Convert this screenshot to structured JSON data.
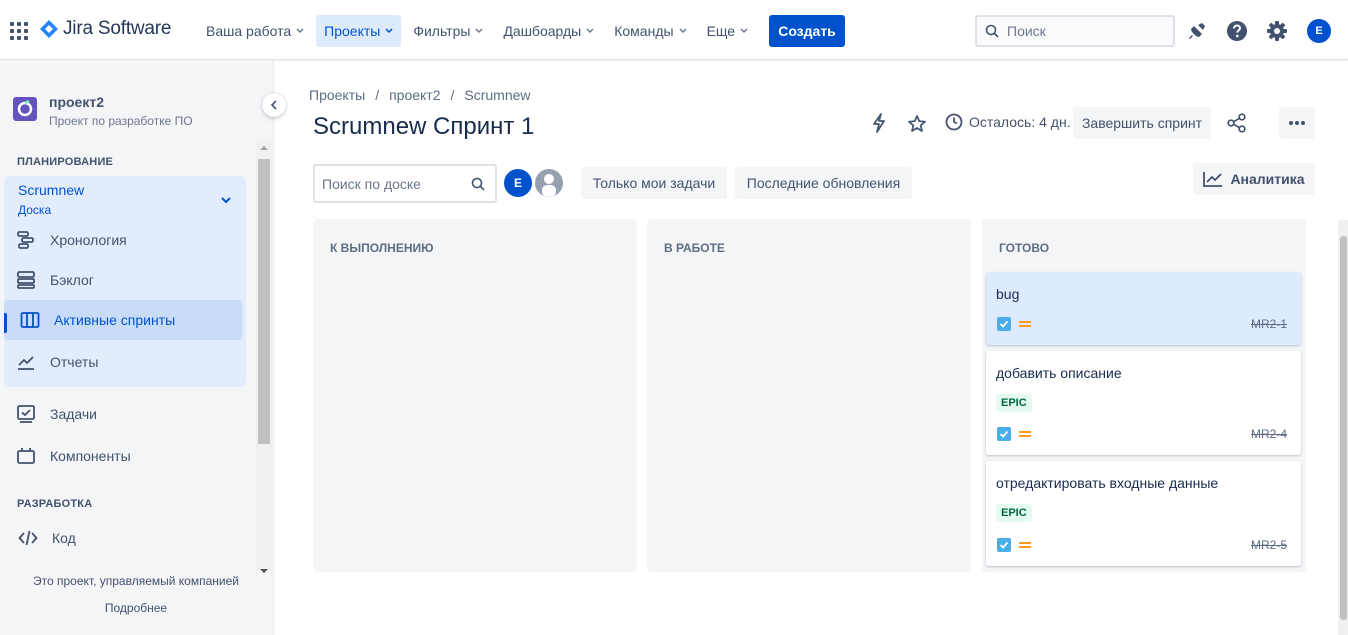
{
  "topnav": {
    "app_name": "Jira Software",
    "menu": [
      {
        "label": "Ваша работа"
      },
      {
        "label": "Проекты"
      },
      {
        "label": "Фильтры"
      },
      {
        "label": "Дашбоарды"
      },
      {
        "label": "Команды"
      },
      {
        "label": "Еще"
      }
    ],
    "create_label": "Создать",
    "search_placeholder": "Поиск",
    "avatar_initial": "E",
    "icons": [
      "app-switcher-icon",
      "notifications-icon",
      "help-icon",
      "settings-icon"
    ]
  },
  "sidebar": {
    "project_name": "проект2",
    "project_type": "Проект по разработке ПО",
    "planning_title": "ПЛАНИРОВАНИЕ",
    "board_name": "Scrumnew",
    "board_sub": "Доска",
    "items": [
      {
        "label": "Хронология",
        "icon": "roadmap-icon"
      },
      {
        "label": "Бэклог",
        "icon": "backlog-icon"
      },
      {
        "label": "Активные спринты",
        "icon": "board-icon"
      },
      {
        "label": "Отчеты",
        "icon": "reports-icon"
      },
      {
        "label": "Задачи",
        "icon": "issues-icon"
      },
      {
        "label": "Компоненты",
        "icon": "components-icon"
      }
    ],
    "dev_title": "РАЗРАБОТКА",
    "dev_items": [
      {
        "label": "Код",
        "icon": "code-icon"
      }
    ],
    "footer_text": "Это проект, управляемый компанией",
    "footer_link": "Подробнее"
  },
  "breadcrumbs": [
    "Проекты",
    "проект2",
    "Scrumnew"
  ],
  "header": {
    "title": "Scrumnew Спринт 1",
    "remaining": "Осталось: 4 дн.",
    "complete_sprint": "Завершить спринт"
  },
  "filters": {
    "search_placeholder": "Поиск по доске",
    "avatar_initial": "E",
    "only_my_issues": "Только мои задачи",
    "recent_updates": "Последние обновления",
    "analytics": "Аналитика"
  },
  "columns": [
    {
      "title": "К ВЫПОЛНЕНИЮ",
      "cards": []
    },
    {
      "title": "В РАБОТЕ",
      "cards": []
    },
    {
      "title": "ГОТОВО",
      "cards": [
        {
          "title": "bug",
          "epic": "",
          "key": "MR2-1"
        },
        {
          "title": "добавить описание",
          "epic": "EPIC",
          "key": "MR2-4"
        },
        {
          "title": "отредактировать входные данные",
          "epic": "EPIC",
          "key": "MR2-5"
        }
      ]
    }
  ],
  "colors": {
    "accent": "#0052cc",
    "epic_bg": "#e3fcef",
    "epic_text": "#006644",
    "priority": "#ff991f",
    "task": "#4bade8"
  }
}
